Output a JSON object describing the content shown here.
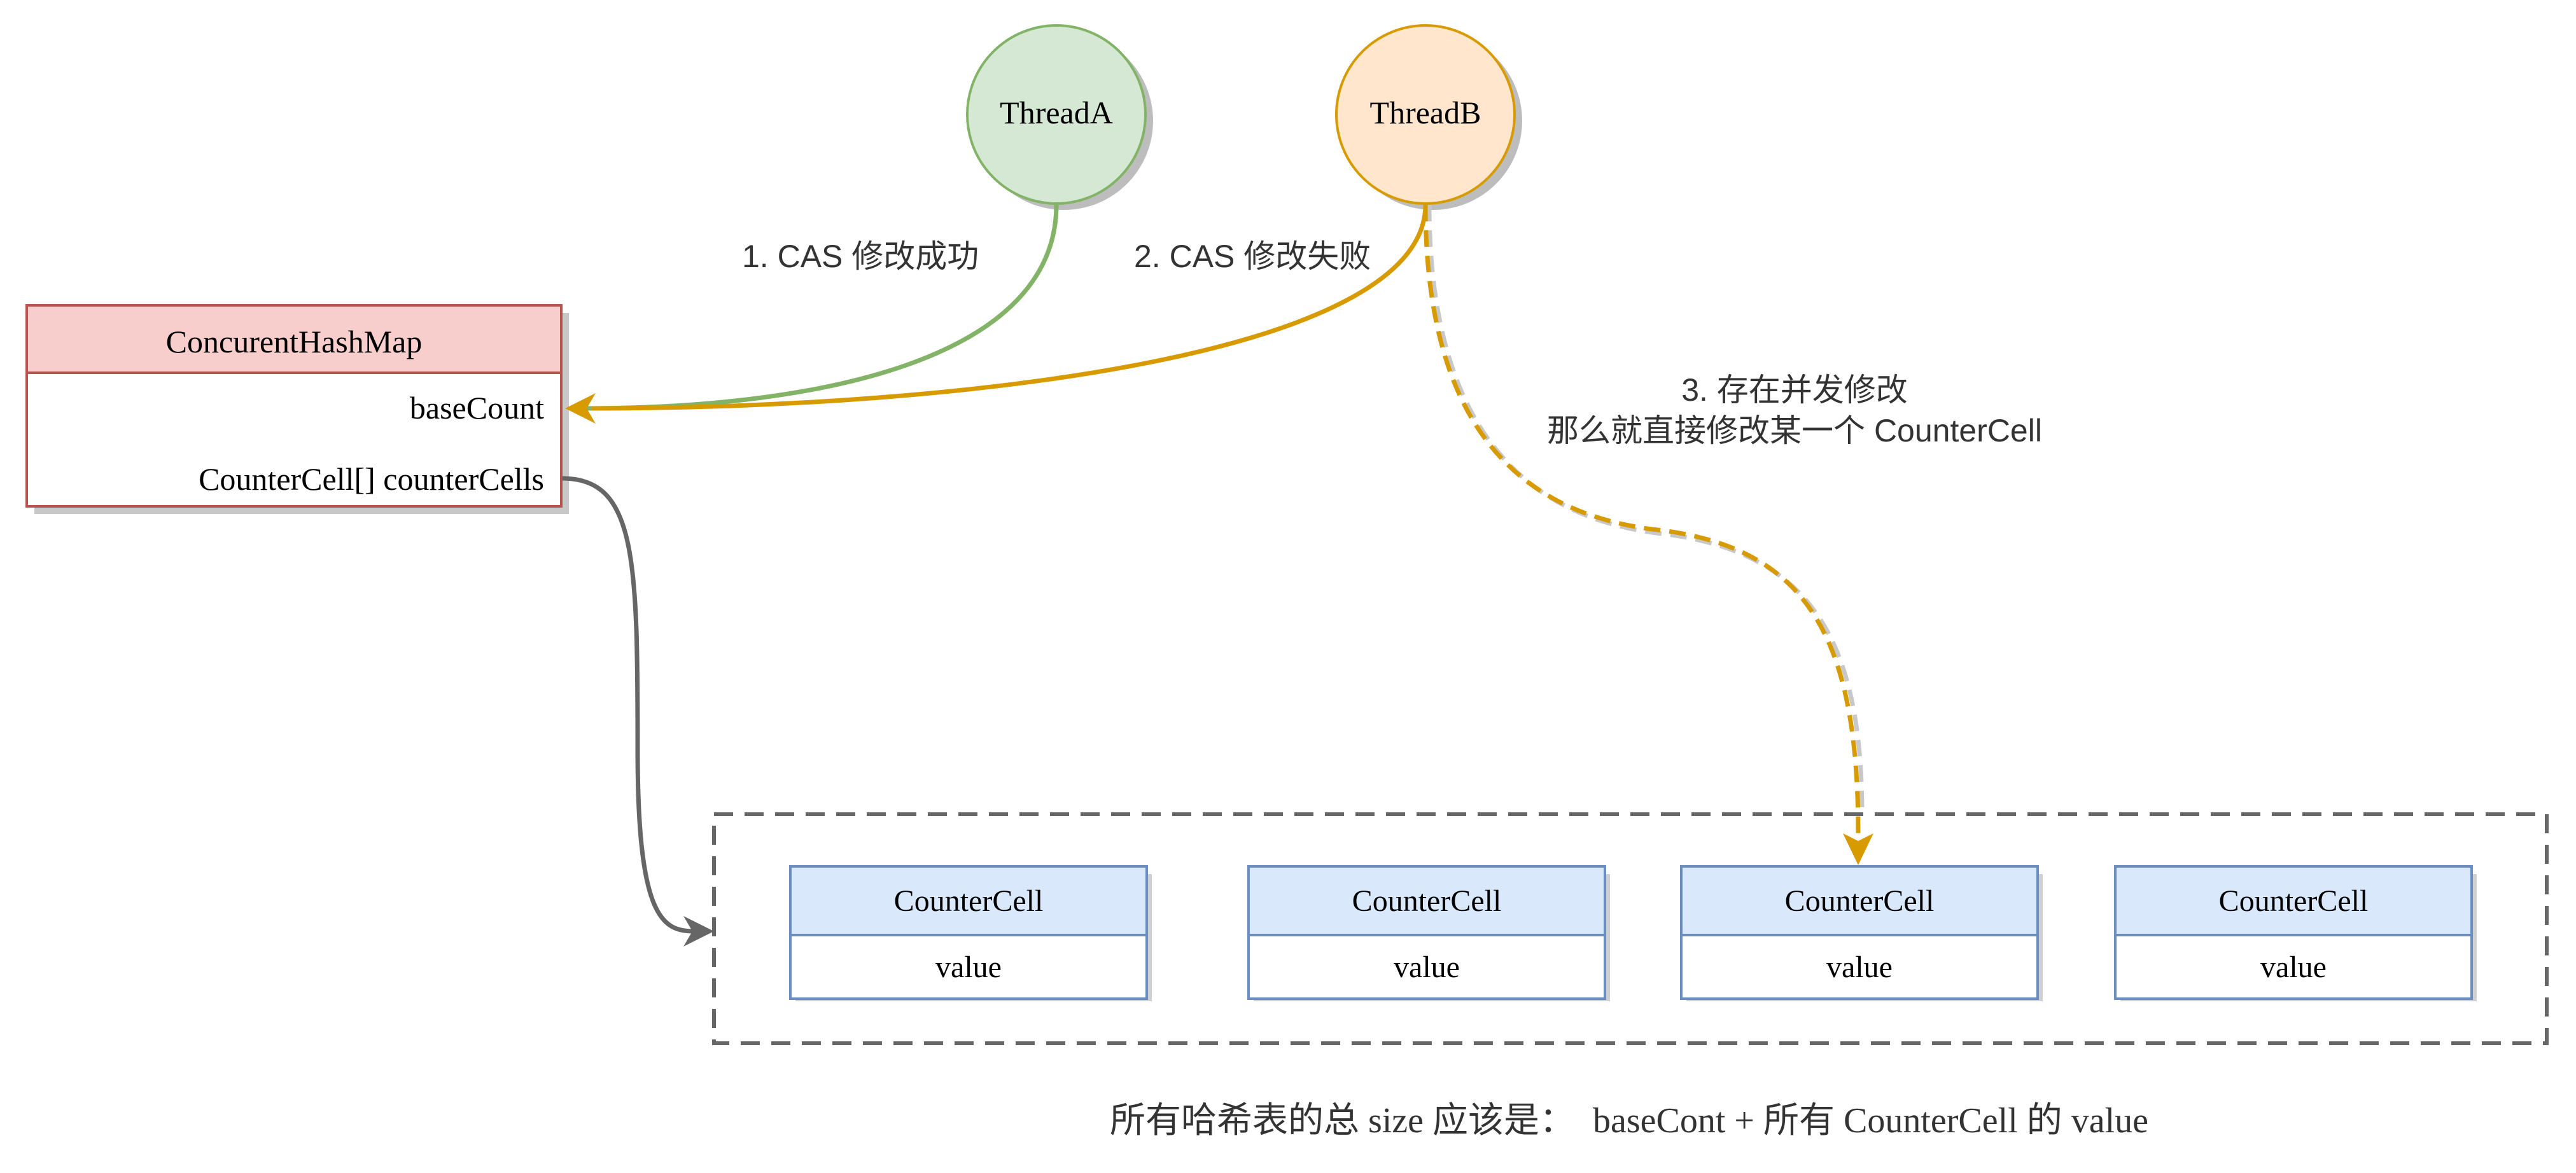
{
  "threads": {
    "a": {
      "label": "ThreadA"
    },
    "b": {
      "label": "ThreadB"
    }
  },
  "map": {
    "title": "ConcurentHashMap",
    "field_base": "baseCount",
    "field_cells": "CounterCell[] counterCells"
  },
  "edges": {
    "step1": "1. CAS 修改成功",
    "step2": "2. CAS 修改失败",
    "step3_line1": "3. 存在并发修改",
    "step3_line2": "那么就直接修改某一个 CounterCell"
  },
  "cells": [
    {
      "title": "CounterCell",
      "field": "value"
    },
    {
      "title": "CounterCell",
      "field": "value"
    },
    {
      "title": "CounterCell",
      "field": "value"
    },
    {
      "title": "CounterCell",
      "field": "value"
    }
  ],
  "footer": "所有哈希表的总 size 应该是：  baseCont + 所有 CounterCell 的 value",
  "colors": {
    "threadA_fill": "#d5e8d4",
    "threadA_stroke": "#82b366",
    "threadB_fill": "#ffe6cc",
    "threadB_stroke": "#d79b00",
    "map_header": "#f8cecc",
    "map_stroke": "#b85450",
    "cell_header": "#dae8fc",
    "cell_stroke": "#6c8ebf",
    "gray_edge": "#666666"
  }
}
